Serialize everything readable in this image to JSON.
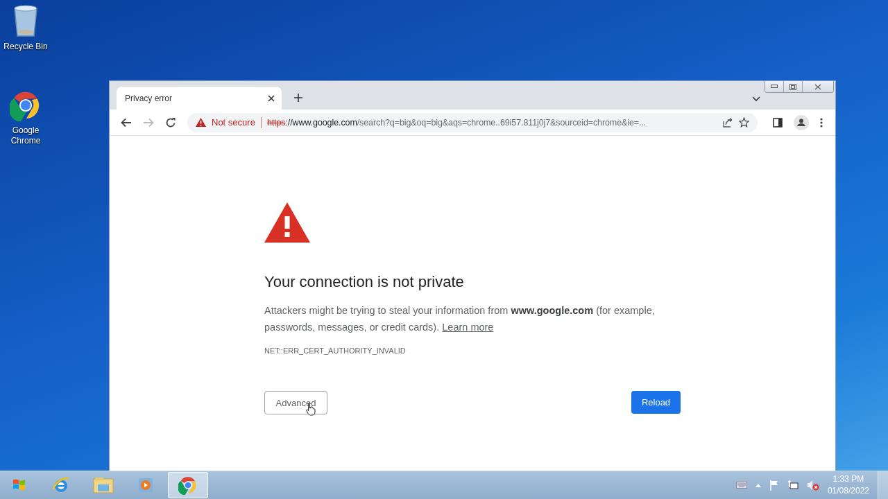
{
  "desktop_icons": [
    {
      "kind": "recycle",
      "label": "Recycle Bin"
    },
    {
      "kind": "chrome",
      "label": "Google Chrome"
    }
  ],
  "browser": {
    "tabs": [
      {
        "title": "Privacy error",
        "selected": true
      }
    ],
    "security_label": "Not secure",
    "url": {
      "scheme": "https",
      "host": "://www.google.com",
      "path": "/search?q=big&oq=big&aqs=chrome..69i57.811j0j7&sourceid=chrome&ie=..."
    },
    "nav": {
      "back_disabled": false,
      "forward_disabled": true
    }
  },
  "page": {
    "heading": "Your connection is not private",
    "message": "Attackers might be trying to steal your information from **www.google.com** (for example, passwords, messages, or credit cards).",
    "link": "Learn more",
    "error_code": "NET::ERR_CERT_AUTHORITY_INVALID",
    "buttons": [
      {
        "kind": "secondary",
        "label": "Advanced"
      },
      {
        "kind": "primary",
        "label": "Reload"
      }
    ]
  },
  "taskbar": {
    "items": [
      {
        "kind": "ie",
        "selected": false
      },
      {
        "kind": "explorer",
        "selected": false
      },
      {
        "kind": "media",
        "selected": false
      },
      {
        "kind": "chrome",
        "selected": true
      }
    ],
    "time": "1:33 PM",
    "date": "01/08/2022"
  }
}
